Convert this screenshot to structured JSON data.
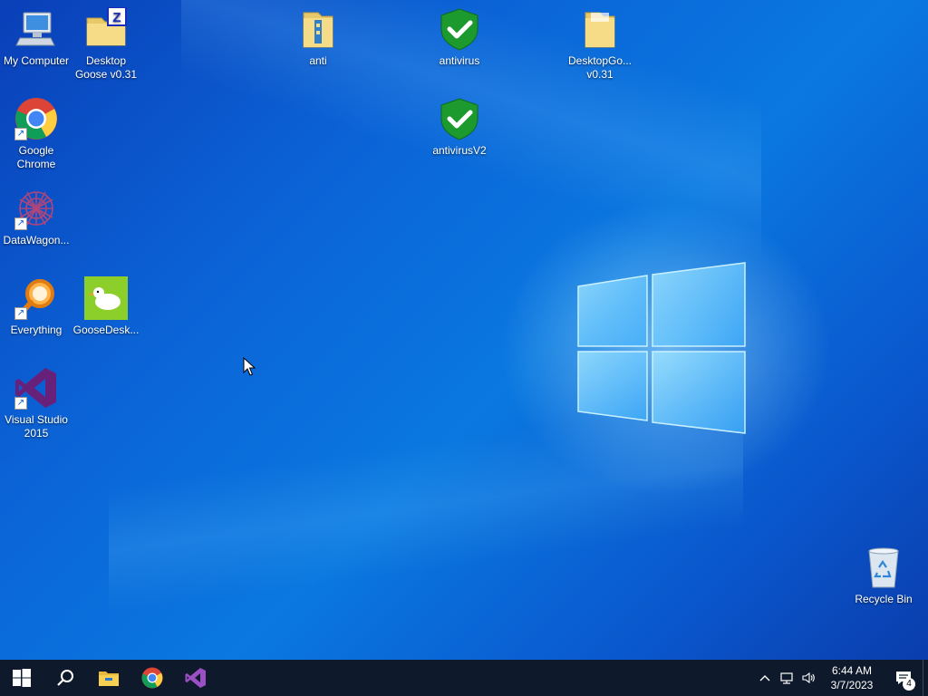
{
  "desktop": {
    "icons": [
      {
        "label": "My Computer",
        "icon": "computer-icon"
      },
      {
        "label": "Desktop Goose v0.31",
        "icon": "zip-folder-icon"
      },
      {
        "label": "anti",
        "icon": "zip-folder-icon"
      },
      {
        "label": "antivirus",
        "icon": "shield-check-icon"
      },
      {
        "label": "DesktopGo... v0.31",
        "icon": "folder-icon"
      },
      {
        "label": "antivirusV2",
        "icon": "shield-check-icon"
      },
      {
        "label": "Google Chrome",
        "icon": "chrome-icon"
      },
      {
        "label": "DataWagon...",
        "icon": "datawagon-icon"
      },
      {
        "label": "Everything",
        "icon": "search-magnifier-icon"
      },
      {
        "label": "GooseDesk...",
        "icon": "goose-icon"
      },
      {
        "label": "Visual Studio 2015",
        "icon": "visual-studio-icon"
      },
      {
        "label": "Recycle Bin",
        "icon": "recycle-bin-icon"
      }
    ]
  },
  "taskbar": {
    "pinned": [
      "windows-start-icon",
      "search-icon",
      "file-explorer-icon",
      "chrome-icon",
      "visual-studio-icon"
    ],
    "tray": {
      "time": "6:44 AM",
      "date": "3/7/2023",
      "notification_count": "4"
    }
  },
  "colors": {
    "taskbar_bg": "#0e1a2b",
    "desktop_accent": "#0a78e0"
  }
}
